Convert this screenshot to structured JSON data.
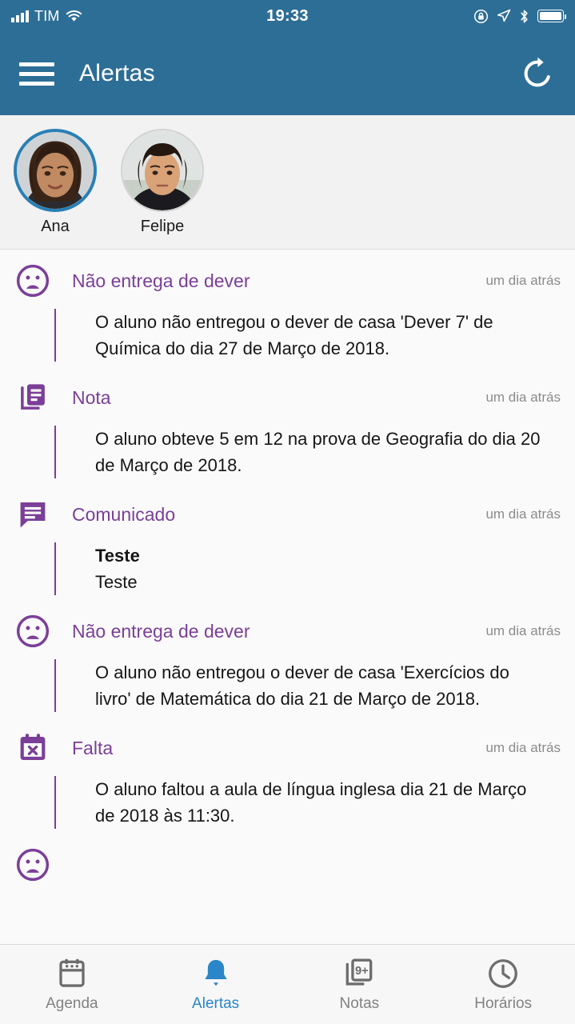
{
  "status_bar": {
    "carrier": "TIM",
    "time": "19:33",
    "signal_icon": "signal-bars-icon",
    "wifi_icon": "wifi-icon",
    "rotation_lock_icon": "rotation-lock-icon",
    "location_icon": "location-arrow-icon",
    "bluetooth_icon": "bluetooth-icon",
    "battery_icon": "battery-icon"
  },
  "nav_bar": {
    "menu_icon": "hamburger-menu-icon",
    "title": "Alertas",
    "refresh_icon": "refresh-icon",
    "background_color": "#2d6e96"
  },
  "students": [
    {
      "name": "Ana",
      "selected": true
    },
    {
      "name": "Felipe",
      "selected": false
    }
  ],
  "alerts": [
    {
      "icon": "sad-face-icon",
      "title": "Não entrega de dever",
      "time": "um dia atrás",
      "body": "O aluno não entregou o dever de casa 'Dever 7' de Química do dia 27 de Março de 2018."
    },
    {
      "icon": "grade-document-icon",
      "title": "Nota",
      "time": "um dia atrás",
      "body": "O aluno obteve 5 em 12 na prova de Geografia do dia 20 de Março de 2018."
    },
    {
      "icon": "speech-bubble-icon",
      "title": "Comunicado",
      "time": "um dia atrás",
      "body_title": "Teste",
      "body": "Teste"
    },
    {
      "icon": "sad-face-icon",
      "title": "Não entrega de dever",
      "time": "um dia atrás",
      "body": "O aluno não entregou o dever de casa 'Exercícios do livro' de Matemática do dia 21 de Março de 2018."
    },
    {
      "icon": "calendar-x-icon",
      "title": "Falta",
      "time": "um dia atrás",
      "body": "O aluno faltou a aula de língua inglesa dia 21 de Março de 2018 às 11:30."
    }
  ],
  "tabs": [
    {
      "label": "Agenda",
      "icon": "calendar-icon",
      "active": false
    },
    {
      "label": "Alertas",
      "icon": "bell-icon",
      "active": true
    },
    {
      "label": "Notas",
      "icon": "grades-icon",
      "active": false,
      "badge": "9+"
    },
    {
      "label": "Horários",
      "icon": "clock-icon",
      "active": false
    }
  ],
  "colors": {
    "header": "#2d6e96",
    "accent_purple": "#7b3f98",
    "tab_active": "#2a86c8",
    "tab_inactive": "#828282"
  }
}
